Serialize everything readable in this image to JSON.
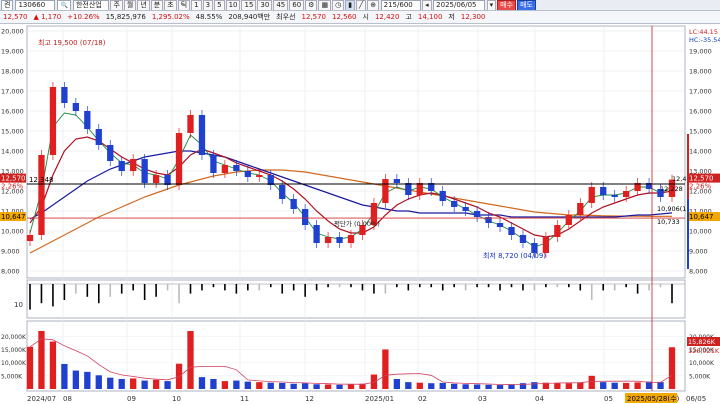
{
  "toolbar": {
    "mode_label": "켠",
    "code": "130660",
    "name": "한전산업",
    "periods": [
      "주",
      "월",
      "년",
      "분",
      "초",
      "틱"
    ],
    "minutes": [
      "1",
      "3",
      "5",
      "10",
      "15",
      "30",
      "45",
      "60"
    ],
    "count": "215/600",
    "date": "2025/06/05",
    "buy_label": "매수",
    "sell_label": "매도"
  },
  "quote": {
    "price": "12,570",
    "change": "▲ 1,170",
    "change_pct": "+10.26%",
    "volume": "15,825,976",
    "volume_pct": "1,295.02%",
    "ratio": "48.55%",
    "amount": "208,940백만",
    "priority_label": "최우선",
    "ask": "12,570",
    "bid": "12,560",
    "open_label": "시",
    "open": "12,420",
    "high_label": "고",
    "high": "14,100",
    "low_label": "저",
    "low": "12,300"
  },
  "price_panel": {
    "y_ticks": [
      "20,000",
      "19,000",
      "18,000",
      "17,000",
      "16,000",
      "15,000",
      "14,000",
      "13,000",
      "12,000",
      "11,000",
      "10,000",
      "9,000",
      "8,000"
    ],
    "y_values": [
      20000,
      19000,
      18000,
      17000,
      16000,
      15000,
      14000,
      13000,
      12000,
      11000,
      10000,
      9000,
      8000
    ],
    "right_ticks": [
      "19,000",
      "18,000",
      "17,000",
      "16,000",
      "15,000",
      "14,000",
      "13,000",
      "12,000",
      "11,000",
      "10,000",
      "9,000",
      "8,000"
    ],
    "right_values": [
      19000,
      18000,
      17000,
      16000,
      15000,
      14000,
      13000,
      12000,
      11000,
      10000,
      9000,
      8000
    ],
    "hline_black": "12,348",
    "hline_black_value": 12348,
    "hline_red": "10,647",
    "hline_red_value": 10647,
    "left_price_tag": "12,570",
    "left_pct_tag": "2.26%",
    "right_price_tag": "12,570",
    "right_pct_tag": "2.26%",
    "right_line_tag": "10,647",
    "lc_label": "LC:44.15",
    "hc_label": "HC:-35.54",
    "max_label": "최고 19,500 (07/18)",
    "min_label": "최저 8,720 (04/09)",
    "avg_label": "평단가 (0.00%)",
    "end_label_1": "12,4",
    "end_label_2": "12,228",
    "end_label_3": "10,906(1",
    "end_label_4": "10,733",
    "series_close": [
      9800,
      13800,
      17200,
      16400,
      16000,
      15100,
      14300,
      13500,
      13000,
      13600,
      12400,
      12800,
      12300,
      14900,
      15800,
      13800,
      12900,
      13300,
      13000,
      12700,
      12800,
      12300,
      11600,
      11100,
      10300,
      9400,
      9700,
      9400,
      9800,
      10300,
      11400,
      12600,
      12400,
      11800,
      12400,
      12000,
      11500,
      11200,
      11000,
      10700,
      10400,
      10200,
      9800,
      9400,
      8900,
      9700,
      10300,
      10800,
      11400,
      12200,
      11800,
      11700,
      12000,
      12400,
      12100,
      11700,
      12570
    ],
    "ma_short": [
      9900,
      12000,
      15200,
      15900,
      15800,
      15200,
      14500,
      13900,
      13400,
      13300,
      12900,
      12800,
      12600,
      13600,
      14800,
      14300,
      13500,
      13300,
      13100,
      12900,
      12800,
      12500,
      11900,
      11400,
      10700,
      9900,
      9700,
      9600,
      9700,
      10100,
      10900,
      11900,
      12200,
      12000,
      12200,
      12100,
      11700,
      11400,
      11100,
      10800,
      10500,
      10300,
      10000,
      9600,
      9200,
      9400,
      9900,
      10500,
      11000,
      11700,
      11800,
      11800,
      11900,
      12200,
      12200,
      11900,
      12200
    ],
    "ma_mid": [
      10400,
      11200,
      12800,
      14000,
      14600,
      14700,
      14500,
      14100,
      13700,
      13400,
      13100,
      12900,
      12800,
      13200,
      13800,
      14100,
      13900,
      13700,
      13400,
      13200,
      13000,
      12800,
      12500,
      12100,
      11600,
      11000,
      10500,
      10100,
      9900,
      9900,
      10200,
      10800,
      11300,
      11600,
      11800,
      11900,
      11800,
      11600,
      11400,
      11200,
      10900,
      10700,
      10400,
      10100,
      9800,
      9700,
      9800,
      10100,
      10500,
      10900,
      11200,
      11400,
      11600,
      11800,
      11900,
      11900,
      12000
    ],
    "ma_long": [
      10600,
      10900,
      11300,
      11700,
      12100,
      12500,
      12800,
      13100,
      13300,
      13500,
      13700,
      13800,
      13900,
      14000,
      14000,
      13900,
      13800,
      13700,
      13500,
      13300,
      13100,
      12900,
      12700,
      12500,
      12300,
      12100,
      11900,
      11700,
      11500,
      11300,
      11200,
      11100,
      11000,
      11000,
      10900,
      10900,
      10900,
      10900,
      10900,
      10800,
      10800,
      10800,
      10700,
      10700,
      10700,
      10700,
      10700,
      10700,
      10700,
      10700,
      10700,
      10700,
      10750,
      10800,
      10800,
      10850,
      10906
    ],
    "ma_trend": [
      8900,
      9200,
      9500,
      9800,
      10100,
      10400,
      10700,
      10950,
      11200,
      11450,
      11700,
      11900,
      12100,
      12300,
      12450,
      12600,
      12750,
      12850,
      12950,
      13000,
      13050,
      13050,
      13050,
      13000,
      12950,
      12850,
      12750,
      12650,
      12550,
      12450,
      12350,
      12250,
      12150,
      12050,
      11950,
      11850,
      11750,
      11650,
      11550,
      11450,
      11350,
      11250,
      11150,
      11050,
      10950,
      10900,
      10850,
      10800,
      10800,
      10780,
      10760,
      10750,
      10740,
      10740,
      10735,
      10733,
      10733
    ]
  },
  "osc_panel": {
    "tick": "10",
    "values": [
      -8,
      -6,
      -7,
      -5,
      3,
      -4,
      -6,
      4,
      -3,
      -2,
      -5,
      -4,
      2,
      6,
      -3,
      -2,
      -1,
      -2,
      -3,
      -2,
      2,
      -1,
      -3,
      -2,
      -4,
      -2,
      -1,
      1,
      -1,
      -2,
      -3,
      3,
      -1,
      -2,
      -1,
      -1,
      -2,
      -1,
      2,
      -1,
      -1,
      -2,
      -1,
      -2,
      2,
      -1,
      1,
      -1,
      -2,
      5,
      -2,
      2,
      -1,
      -3,
      2,
      1,
      -6
    ]
  },
  "volume_panel": {
    "y_ticks": [
      "20,000K",
      "15,000K",
      "10,000K",
      "5,000K"
    ],
    "y_values": [
      20000,
      15000,
      10000,
      5000
    ],
    "right_ticks": [
      "20,000K",
      "15,000K",
      "10,000K",
      "5,000K"
    ],
    "right_values": [
      20000,
      15000,
      10000,
      5000
    ],
    "right_tag_1": "15,826K",
    "right_tag_2": "126,021K",
    "values": [
      16000,
      22000,
      18000,
      9500,
      7000,
      6500,
      5200,
      4300,
      3800,
      4000,
      3200,
      3500,
      3000,
      9600,
      22000,
      4500,
      3800,
      3000,
      3200,
      2800,
      2600,
      2400,
      2300,
      2000,
      2200,
      1800,
      1700,
      1600,
      1800,
      2000,
      5500,
      15000,
      3800,
      2600,
      2400,
      2200,
      2300,
      2000,
      1800,
      1700,
      1600,
      1500,
      1800,
      2200,
      2600,
      2400,
      2300,
      2200,
      2500,
      5000,
      2600,
      2400,
      2300,
      2500,
      2800,
      2600,
      15826
    ]
  },
  "x_axis": {
    "labels": [
      "2024/07",
      "08",
      "09",
      "10",
      "11",
      "12",
      "2025/01",
      "02",
      "03",
      "04",
      "05",
      "06/05"
    ],
    "cursor_label": "2025/05/28(수)"
  }
}
